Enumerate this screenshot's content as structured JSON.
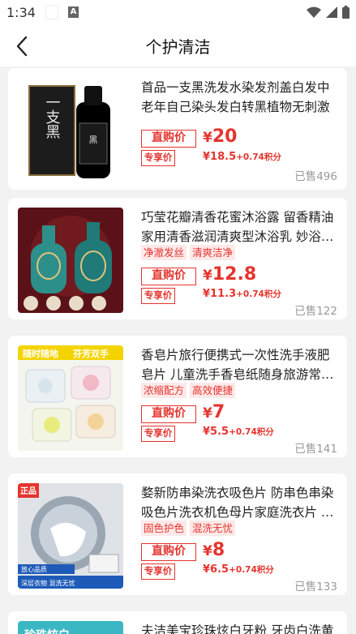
{
  "status_bar": {
    "time": "1:34"
  },
  "header": {
    "title": "个护清洁"
  },
  "products": [
    {
      "title": "首品一支黑洗发水染发剂盖白发中老年自己染头发白转黑植物无刺激",
      "tags": [],
      "price_label": "直购价",
      "price": "20",
      "vip_label": "专享价",
      "vip_price": "18.5",
      "vip_points": "+0.74积分",
      "sold": "已售496",
      "image_text": "一支黑"
    },
    {
      "title": "巧莹花瓣清香花蜜沐浴露 留香精油家用清香滋润清爽型沐浴乳 妙浴…",
      "tags": [
        "净澈发丝",
        "清爽洁净"
      ],
      "price_label": "直购价",
      "price": "12.8",
      "vip_label": "专享价",
      "vip_price": "11.3",
      "vip_points": "+0.74积分",
      "sold": "已售122"
    },
    {
      "title": "香皂片旅行便携式一次性洗手液肥皂片 儿童洗手香皂纸随身旅游常…",
      "tags": [
        "浓缩配方",
        "高效便捷"
      ],
      "price_label": "直购价",
      "price": "7",
      "vip_label": "专享价",
      "vip_price": "5.5",
      "vip_points": "+0.74积分",
      "sold": "已售141",
      "image_text_1": "随时随地",
      "image_text_2": "芬芳双手"
    },
    {
      "title": "婺新防串染洗衣吸色片 防串色串染吸色片洗衣机色母片家庭洗衣片 …",
      "tags": [
        "固色护色",
        "混洗无忧"
      ],
      "price_label": "直购价",
      "price": "8",
      "vip_label": "专享价",
      "vip_price": "6.5",
      "vip_points": "+0.74积分",
      "sold": "已售133",
      "image_text_1": "正品",
      "image_text_2": "放心品质",
      "image_text_3": "深层衣物 混洗无忧"
    },
    {
      "title": "夫洁美宝珍珠炫白牙粉 牙齿白洗黄",
      "image_text": "珍珠炫白"
    }
  ],
  "colors": {
    "accent": "#e5342e",
    "tag_bg": "#fde9e8",
    "page_bg": "#f2f2f2"
  }
}
